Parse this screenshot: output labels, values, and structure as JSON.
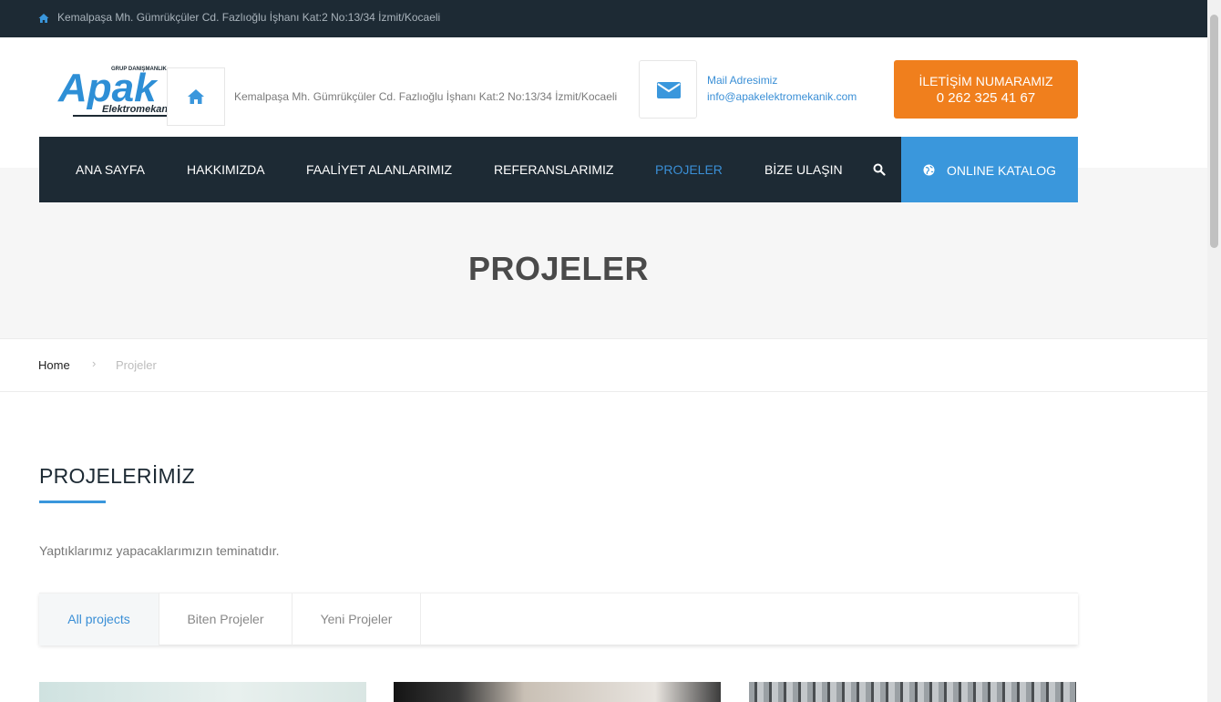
{
  "topbar": {
    "address": "Kemalpaşa Mh. Gümrükçüler Cd. Fazlıoğlu İşhanı Kat:2 No:13/34 İzmit/Kocaeli"
  },
  "header": {
    "address": "Kemalpaşa Mh. Gümrükçüler Cd. Fazlıoğlu İşhanı Kat:2 No:13/34 İzmit/Kocaeli",
    "logo": {
      "text": "Apak",
      "tagline": "GRUP DANIŞMANLIK",
      "subtitle": "Elektromekanik"
    },
    "mail": {
      "label": "Mail Adresimiz",
      "value": "info@apakelektromekanik.com"
    },
    "call": {
      "label": "İLETİŞİM NUMARAMIZ",
      "number": "0 262 325 41 67"
    }
  },
  "nav": {
    "items": [
      {
        "label": "ANA SAYFA"
      },
      {
        "label": "HAKKIMIZDA"
      },
      {
        "label": "FAALİYET ALANLARIMIZ"
      },
      {
        "label": "REFERANSLARIMIZ"
      },
      {
        "label": "PROJELER"
      },
      {
        "label": "BİZE ULAŞIN"
      }
    ],
    "catalog_label": "ONLINE KATALOG"
  },
  "hero": {
    "title": "PROJELER"
  },
  "breadcrumb": {
    "home": "Home",
    "separator": "›",
    "current": "Projeler"
  },
  "section": {
    "title": "PROJELERİMİZ",
    "description": "Yaptıklarımız yapacaklarımızın teminatıdır."
  },
  "tabs": [
    {
      "label": "All projects"
    },
    {
      "label": "Biten Projeler"
    },
    {
      "label": "Yeni Projeler"
    }
  ],
  "colors": {
    "dark": "#1d2a34",
    "accent": "#3a97dc",
    "orange": "#f07f1d"
  }
}
